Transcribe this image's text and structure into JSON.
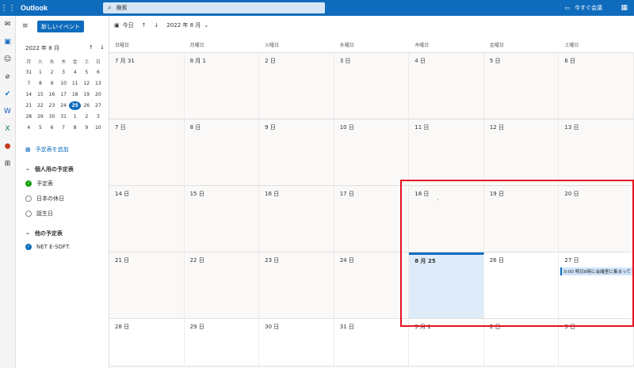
{
  "topbar": {
    "brand": "Outlook",
    "search_placeholder": "検索",
    "meet_now": "今すぐ会議"
  },
  "sidebar": {
    "new_event": "新しいイベント",
    "mini_cal_title": "2022 年 8 月",
    "weekday_labels": [
      "月",
      "火",
      "水",
      "木",
      "金",
      "土",
      "日"
    ],
    "days": [
      "31",
      "1",
      "2",
      "3",
      "4",
      "5",
      "6",
      "7",
      "8",
      "9",
      "10",
      "11",
      "12",
      "13",
      "14",
      "15",
      "16",
      "17",
      "18",
      "19",
      "20",
      "21",
      "22",
      "23",
      "24",
      "25",
      "26",
      "27",
      "28",
      "29",
      "30",
      "31",
      "1",
      "2",
      "3",
      "4",
      "5",
      "6",
      "7",
      "8",
      "9",
      "10"
    ],
    "today_day": "25",
    "add_calendar": "予定表を追加",
    "personal_section": "個人用の予定表",
    "personal_items": [
      "予定表",
      "日本の休日",
      "誕生日"
    ],
    "other_section": "他の予定表",
    "other_items": [
      "NET E-SOFT."
    ]
  },
  "toolbar": {
    "today": "今日",
    "month_title": "2022 年 8 月"
  },
  "calendar": {
    "weekday_headers": [
      "日曜日",
      "月曜日",
      "火曜日",
      "水曜日",
      "木曜日",
      "金曜日",
      "土曜日"
    ],
    "weeks": [
      [
        "7 月 31",
        "8 月 1",
        "2 日",
        "3 日",
        "4 日",
        "5 日",
        "6 日"
      ],
      [
        "7 日",
        "8 日",
        "9 日",
        "10 日",
        "11 日",
        "12 日",
        "13 日"
      ],
      [
        "14 日",
        "15 日",
        "16 日",
        "17 日",
        "18 日",
        "19 日",
        "20 日"
      ],
      [
        "21 日",
        "22 日",
        "23 日",
        "24 日",
        "8 月 25",
        "26 日",
        "27 日"
      ],
      [
        "28 日",
        "29 日",
        "30 日",
        "31 日",
        "9 月 1",
        "2 日",
        "3 日"
      ]
    ],
    "event_27": "0:00 明日8時に会議室に集まって",
    "dot_mark": "."
  },
  "colors": {
    "accent": "#0f6cbd",
    "highlight": "#e81123"
  }
}
